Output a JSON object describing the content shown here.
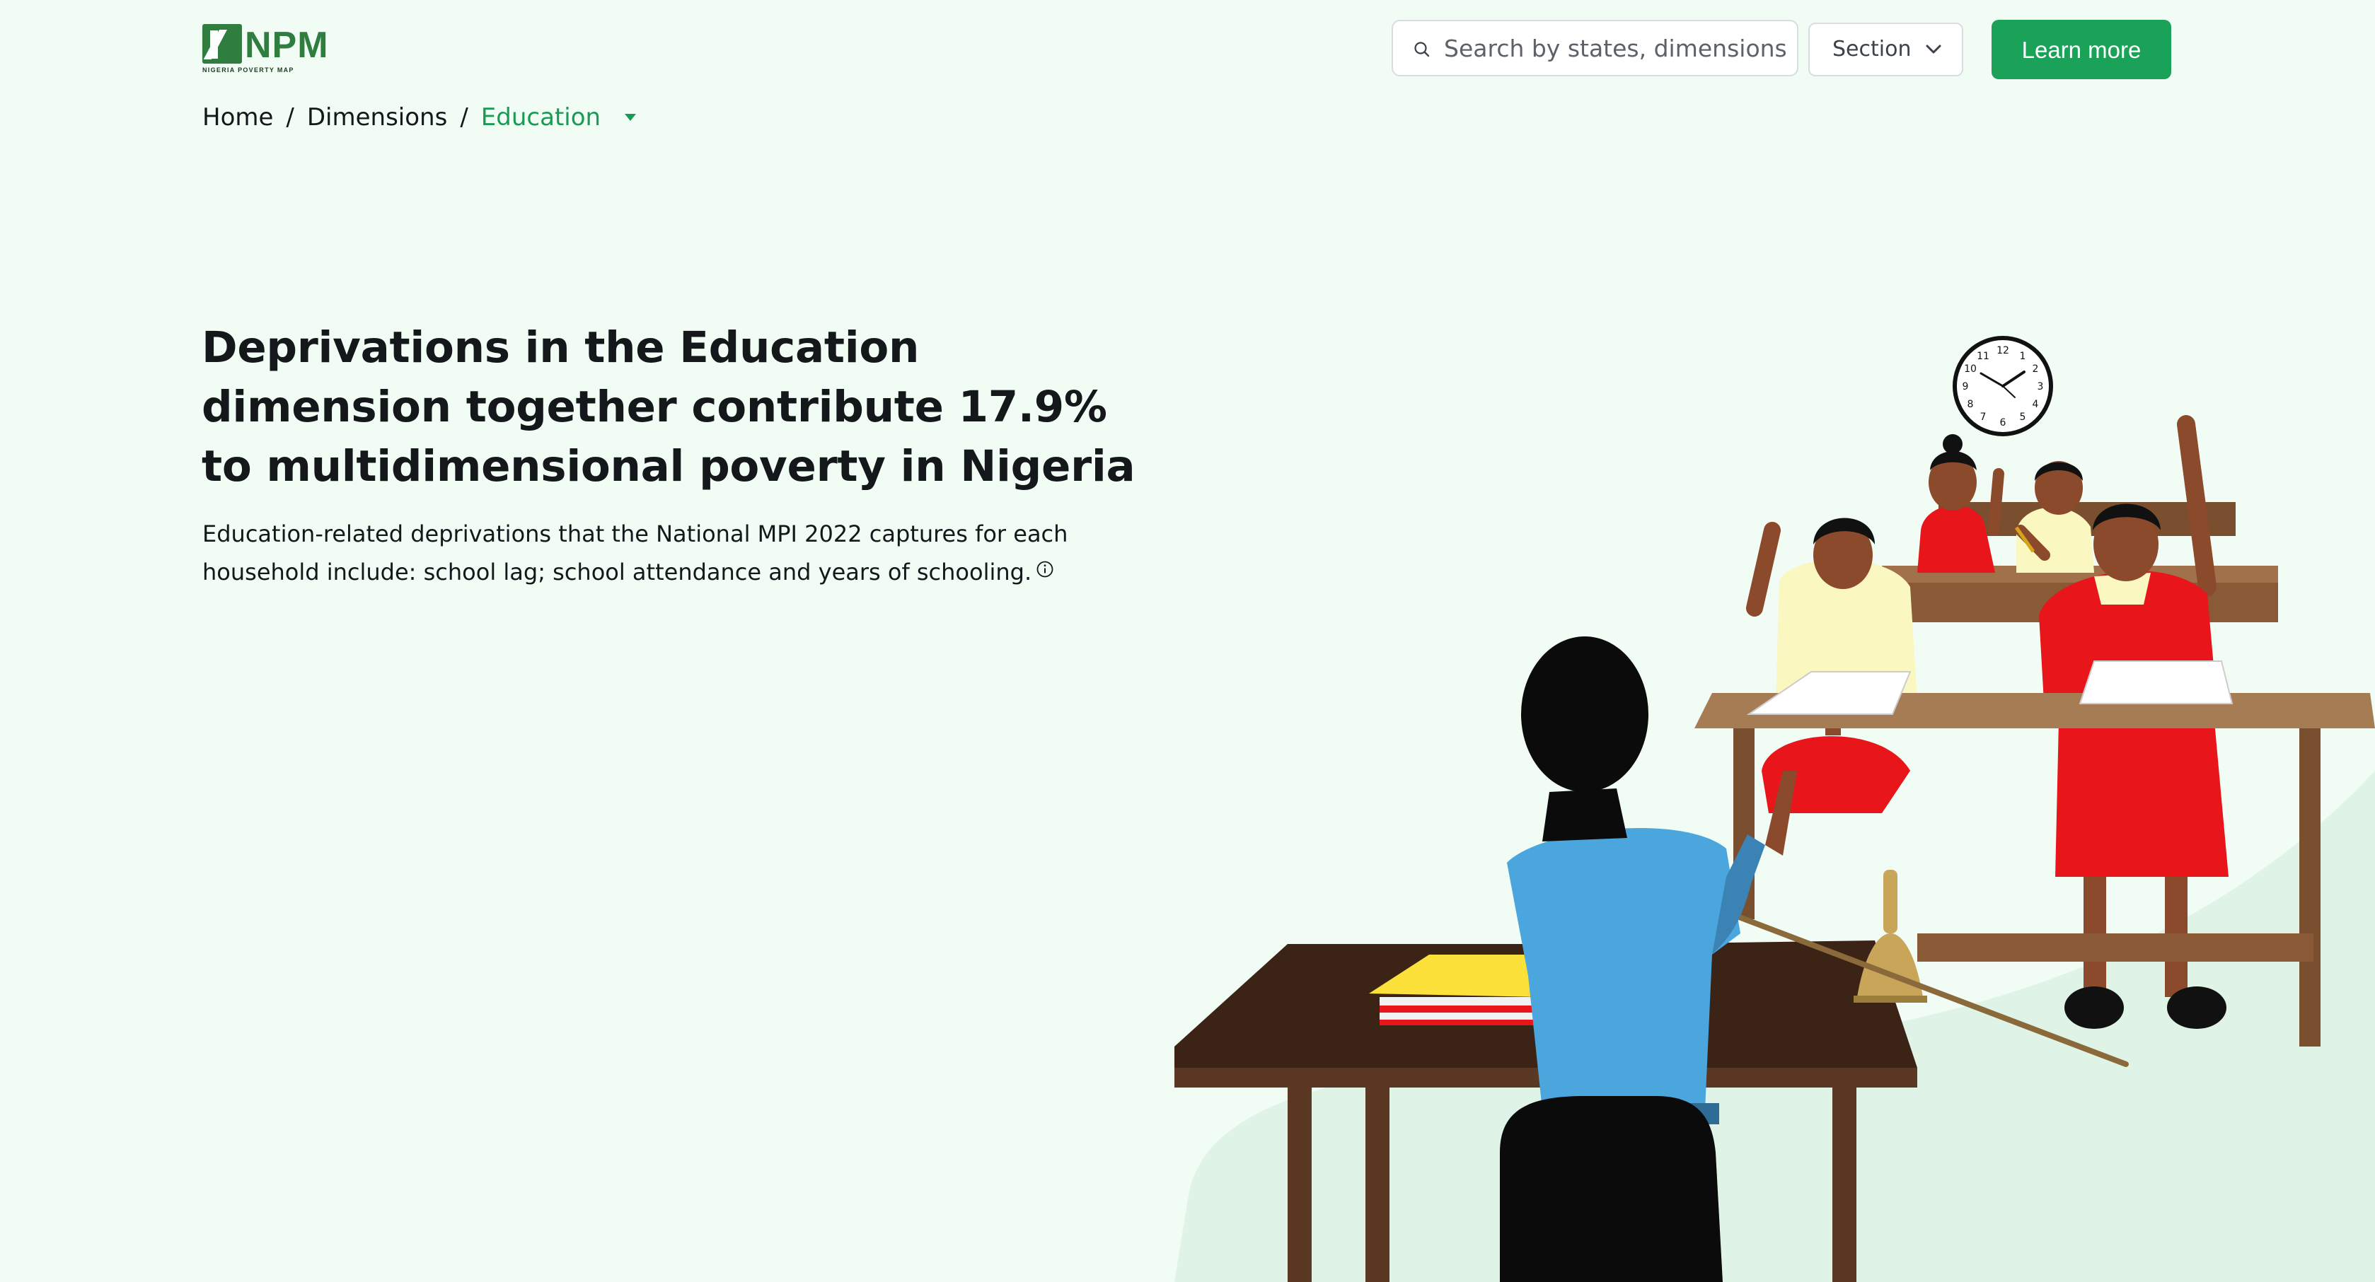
{
  "brand": {
    "letters": "NPM",
    "tagline": "NIGERIA POVERTY MAP",
    "color": "#2f7d3f"
  },
  "search": {
    "placeholder": "Search by states, dimensions",
    "icon": "search-icon"
  },
  "section_select": {
    "label": "Section",
    "icon": "chevron-down-icon"
  },
  "learn_more": {
    "label": "Learn more",
    "color": "#1aa258"
  },
  "breadcrumb": {
    "home": "Home",
    "dimensions": "Dimensions",
    "current": "Education",
    "separator": "/",
    "accent": "#1a9a55",
    "caret_icon": "caret-down-icon"
  },
  "hero": {
    "title": "Deprivations in the Education dimension together contribute 17.9% to multidimensional poverty in Nigeria",
    "description": "Education-related deprivations that the National MPI 2022 captures for each household include: school lag; school attendance and years of schooling.",
    "info_icon": "info-icon"
  },
  "illustration": {
    "subject": "classroom-illustration",
    "clock_numbers": [
      "12",
      "1",
      "2",
      "3",
      "4",
      "5",
      "6",
      "7",
      "8",
      "9",
      "10",
      "11"
    ]
  },
  "colors": {
    "page_background": "#f1fcf5",
    "text": "#14181b"
  }
}
